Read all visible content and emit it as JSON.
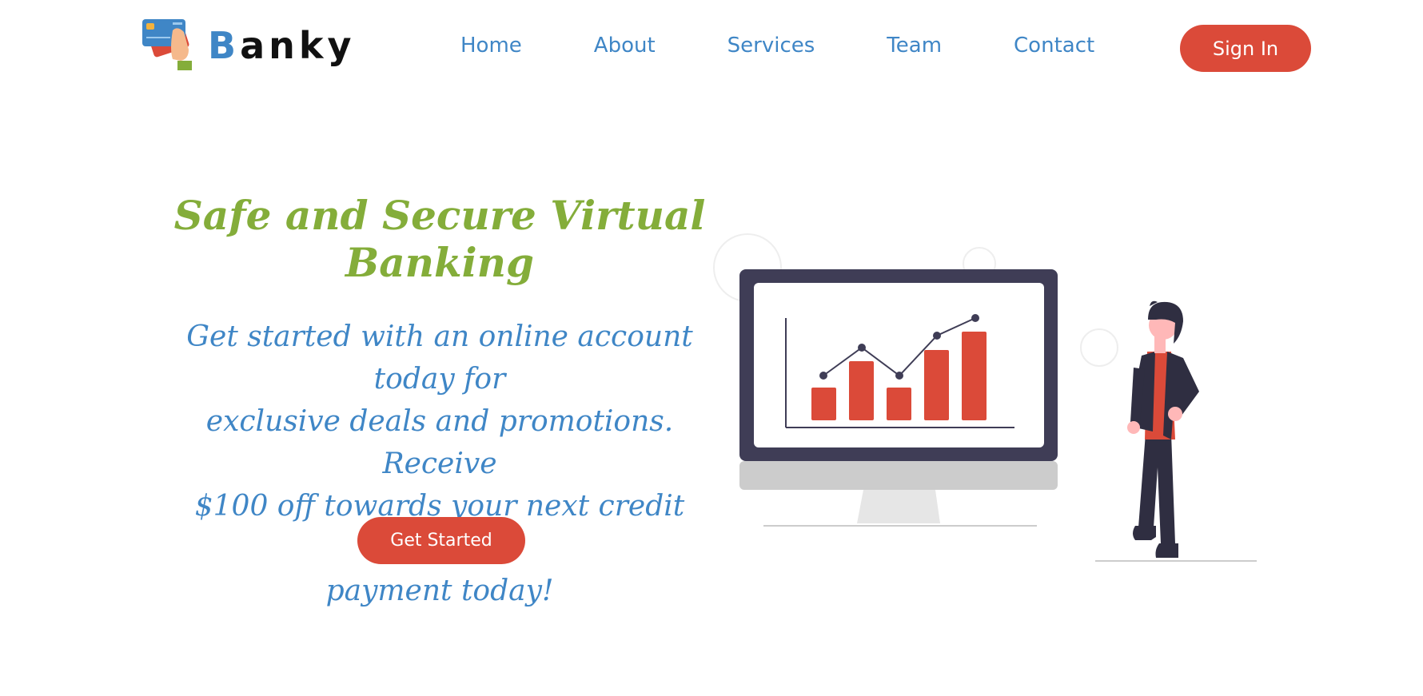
{
  "brand": {
    "first_letter": "B",
    "rest": "anky",
    "icon": "credit-card-hand-icon"
  },
  "nav": {
    "items": [
      {
        "label": "Home"
      },
      {
        "label": "About"
      },
      {
        "label": "Services"
      },
      {
        "label": "Team"
      },
      {
        "label": "Contact"
      }
    ],
    "signin_label": "Sign In"
  },
  "hero": {
    "title": "Safe and Secure Virtual Banking",
    "text_lines": [
      "Get started with an online account today for",
      "exclusive deals and promotions. Receive",
      "$100 off towards your next credit card",
      "payment today!"
    ],
    "cta_label": "Get Started"
  },
  "illustration": {
    "name": "person-with-growth-chart-monitor",
    "colors": {
      "accent_red": "#db4a39",
      "dark": "#3f3d56",
      "brand_blue": "#3f86c6",
      "brand_green": "#84ad3a"
    }
  }
}
